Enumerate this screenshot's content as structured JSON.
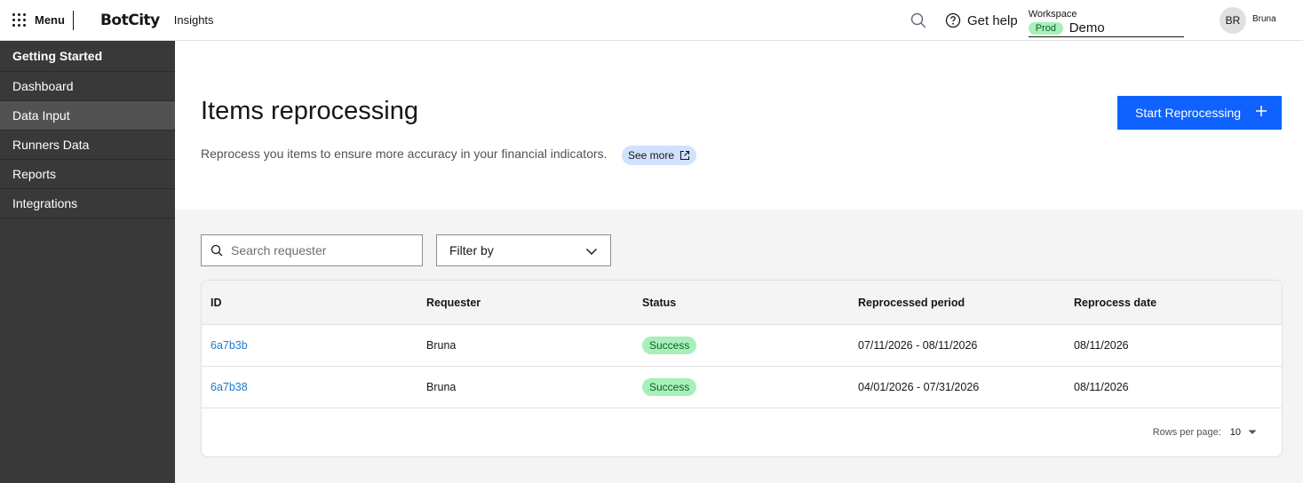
{
  "header": {
    "menu_label": "Menu",
    "logo": "BotCity",
    "product": "Insights",
    "help_label": "Get help",
    "workspace_label": "Workspace",
    "workspace_env": "Prod",
    "workspace_name": "Demo",
    "avatar_initials": "BR",
    "user_name": "Bruna"
  },
  "sidebar": {
    "items": [
      {
        "label": "Getting Started"
      },
      {
        "label": "Dashboard"
      },
      {
        "label": "Data Input"
      },
      {
        "label": "Runners Data"
      },
      {
        "label": "Reports"
      },
      {
        "label": "Integrations"
      }
    ]
  },
  "main": {
    "title": "Items reprocessing",
    "description": "Reprocess you items to ensure more accuracy in your financial indicators.",
    "see_more": "See more",
    "primary_button": "Start Reprocessing",
    "search_placeholder": "Search requester",
    "filter_label": "Filter by"
  },
  "table": {
    "columns": [
      "ID",
      "Requester",
      "Status",
      "Reprocessed period",
      "Reprocess date"
    ],
    "rows": [
      {
        "id": "6a7b3b",
        "requester": "Bruna",
        "status": "Success",
        "period": "07/11/2026 - 08/11/2026",
        "date": "08/11/2026"
      },
      {
        "id": "6a7b38",
        "requester": "Bruna",
        "status": "Success",
        "period": "04/01/2026 - 07/31/2026",
        "date": "08/11/2026"
      }
    ],
    "rows_per_page_label": "Rows per page:",
    "rows_per_page_value": "10"
  },
  "colors": {
    "primary": "#0f62fe",
    "sidebar_bg": "#393939",
    "success_bg": "#a7f0ba"
  }
}
